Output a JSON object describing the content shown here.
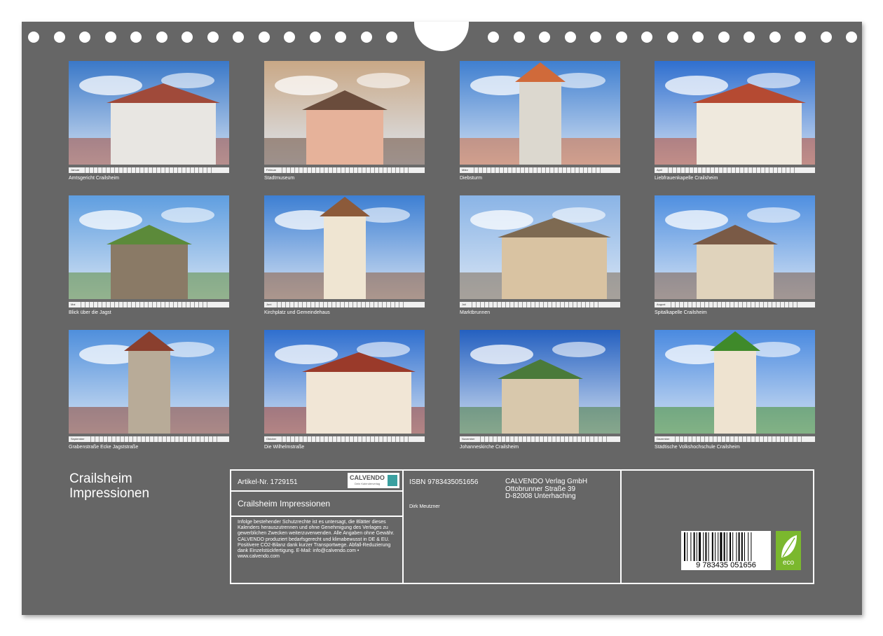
{
  "months": [
    "Januar",
    "Februar",
    "März",
    "April",
    "Mai",
    "Juni",
    "Juli",
    "August",
    "September",
    "Oktober",
    "November",
    "Dezember"
  ],
  "photos": [
    {
      "caption": "Amtsgericht Crailsheim",
      "sky": "#3a78c8",
      "body": "#e8e6e2",
      "accent": "#a04a3a"
    },
    {
      "caption": "Stadtmuseum",
      "sky": "#c9a886",
      "body": "#e6b29a",
      "accent": "#6a4c3c"
    },
    {
      "caption": "Diebsturm",
      "sky": "#3f7fd0",
      "body": "#dcd8cf",
      "accent": "#d06a3a"
    },
    {
      "caption": "Liebfrauenkapelle Crailsheim",
      "sky": "#2f6fcf",
      "body": "#efe9dd",
      "accent": "#b54a32"
    },
    {
      "caption": "Blick über die Jagst",
      "sky": "#5f9ee0",
      "body": "#8a7a66",
      "accent": "#5c8a3a"
    },
    {
      "caption": "Kirchplatz und Gemeindehaus",
      "sky": "#3d7fd3",
      "body": "#efe5d2",
      "accent": "#8c5a3a"
    },
    {
      "caption": "Marktbrunnen",
      "sky": "#8ab4e6",
      "body": "#d9c3a2",
      "accent": "#7e6a52"
    },
    {
      "caption": "Spitalkapelle Crailsheim",
      "sky": "#4f8fe0",
      "body": "#e0d3bc",
      "accent": "#7a5a46"
    },
    {
      "caption": "Grabenstraße Ecke Jagststraße",
      "sky": "#4f8fdc",
      "body": "#b8ab98",
      "accent": "#8a3f2e"
    },
    {
      "caption": "Die Wilhelmstraße",
      "sky": "#2f6fcf",
      "body": "#f1e6d6",
      "accent": "#9a3a2a"
    },
    {
      "caption": "Johanneskirche Crailsheim",
      "sky": "#2460c0",
      "body": "#d8c8ac",
      "accent": "#4a7a3a"
    },
    {
      "caption": "Städtische Volkshochschule Crailsheim",
      "sky": "#4a8ae0",
      "body": "#eee3d0",
      "accent": "#3f8a2a"
    }
  ],
  "calendar_title": {
    "line1": "Crailsheim",
    "line2": "Impressionen"
  },
  "info": {
    "article": "Artikel-Nr. 1729151",
    "logo_text": "CALVENDO",
    "logo_sub": "Dein Kalenderverlag",
    "product_title": "Crailsheim Impressionen",
    "legal": "Infolge bestehender Schutzrechte ist es untersagt, die Blätter dieses Kalenders herauszutrennen und ohne Genehmigung des Verlages zu gewerblichen Zwecken weiterzuverwenden. Alle Angaben ohne Gewähr. CALVENDO produziert bedarfsgerecht und klimabewusst in DE & EU. Positivere CO2-Bilanz dank kurzer Transportwege. Abfall-Reduzierung dank Einzelstückfertigung. E-Mail: info@calvendo.com • www.calvendo.com",
    "isbn": "ISBN 9783435051656",
    "publisher1": "CALVENDO Verlag GmbH",
    "publisher2": "Ottobrunner Straße 39",
    "publisher3": "D-82008 Unterhaching",
    "author": "Dirk Meutzner",
    "barcode_number": "9 783435 051656",
    "eco_label": "eco"
  }
}
